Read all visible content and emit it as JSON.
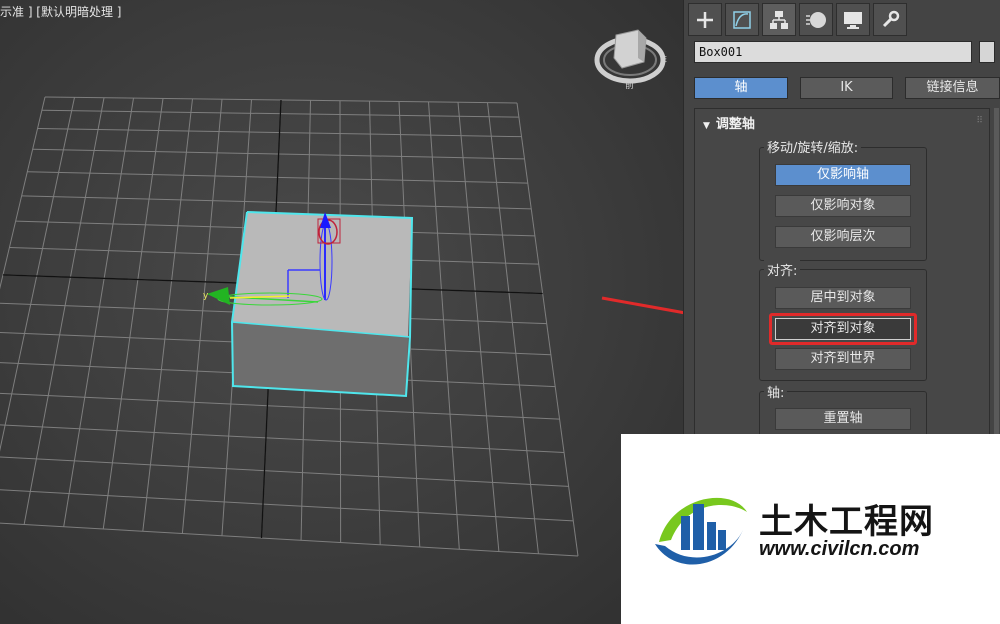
{
  "viewport": {
    "label": "示准 ] [默认明暗处理 ]",
    "viewcube_labels": [
      "前",
      "E"
    ]
  },
  "panel": {
    "tabs": [
      {
        "name": "create",
        "icon": "plus-icon"
      },
      {
        "name": "modify",
        "icon": "modify-curve-icon"
      },
      {
        "name": "hierarchy",
        "icon": "hierarchy-icon"
      },
      {
        "name": "motion",
        "icon": "motion-sphere-icon"
      },
      {
        "name": "display",
        "icon": "monitor-icon"
      },
      {
        "name": "utilities",
        "icon": "wrench-icon"
      }
    ],
    "object_name": "Box001",
    "subtabs": [
      "轴",
      "IK",
      "链接信息"
    ],
    "rollout": {
      "title": "调整轴",
      "move_group": {
        "label": "移动/旋转/缩放:",
        "buttons": [
          "仅影响轴",
          "仅影响对象",
          "仅影响层次"
        ]
      },
      "align_group": {
        "label": "对齐:",
        "buttons": [
          "居中到对象",
          "对齐到对象",
          "对齐到世界"
        ]
      },
      "axis_group": {
        "label": "轴:",
        "buttons": [
          "重置轴"
        ]
      }
    }
  },
  "watermark": {
    "title": "土木工程网",
    "url": "www.civilcn.com"
  },
  "colors": {
    "accent": "#5c8fce",
    "selection": "#4fe6ec",
    "annotation_red": "#e12a2a"
  }
}
